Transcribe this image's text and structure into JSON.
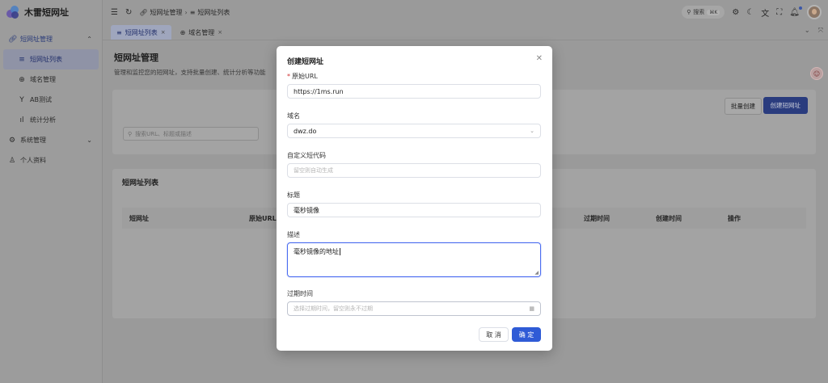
{
  "app": {
    "title": "木雷短网址"
  },
  "sidebar": {
    "items": [
      {
        "label": "短网址管理",
        "icon": "link-icon"
      },
      {
        "label": "短网址列表",
        "icon": "list-icon"
      },
      {
        "label": "域名管理",
        "icon": "globe-icon"
      },
      {
        "label": "AB测试",
        "icon": "branch-icon"
      },
      {
        "label": "统计分析",
        "icon": "bar-chart-icon"
      },
      {
        "label": "系统管理",
        "icon": "gear-icon"
      },
      {
        "label": "个人资料",
        "icon": "user-icon"
      }
    ]
  },
  "header": {
    "breadcrumb": [
      "短网址管理",
      "短网址列表"
    ],
    "search_label": "搜索",
    "search_kbd": "⌘K"
  },
  "tabs": [
    {
      "label": "短网址列表"
    },
    {
      "label": "域名管理"
    }
  ],
  "page": {
    "title": "短网址管理",
    "description": "管理和监控您的短网址，支持批量创建、统计分析等功能",
    "batch_create": "批量创建",
    "create_short_url": "创建短网址",
    "search_placeholder": "搜索URL、标题或描述",
    "list_title": "短网址列表",
    "columns": [
      "短网址",
      "原始URL",
      "过期时间",
      "创建时间",
      "操作"
    ]
  },
  "modal": {
    "title": "创建短网址",
    "original_url_label": "原始URL",
    "original_url_value": "https://1ms.run",
    "domain_label": "域名",
    "domain_value": "dwz.do",
    "custom_code_label": "自定义短代码",
    "custom_code_placeholder": "留空则自动生成",
    "title_label": "标题",
    "title_value": "毫秒镜像",
    "description_label": "描述",
    "description_value": "毫秒镜像的地址",
    "expire_label": "过期时间",
    "expire_placeholder": "选择过期时间，留空则永不过期",
    "cancel": "取 消",
    "confirm": "确 定"
  },
  "colors": {
    "primary": "#2f5bd6",
    "overlay": "#9a9a9a",
    "active_nav": "#23306b"
  }
}
